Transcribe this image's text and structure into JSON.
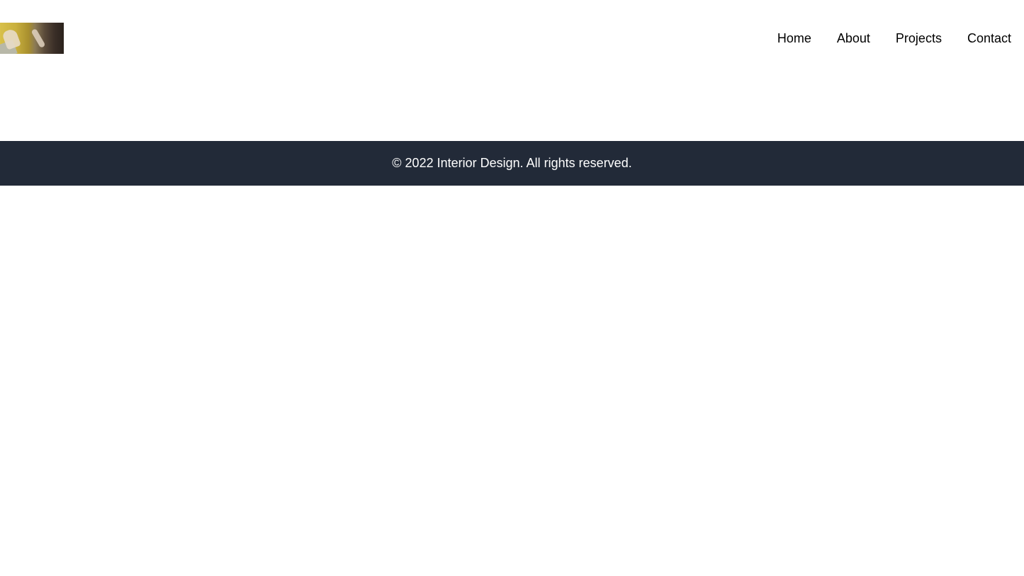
{
  "header": {
    "logo_alt": "Interior Design logo",
    "nav": [
      {
        "label": "Home"
      },
      {
        "label": "About"
      },
      {
        "label": "Projects"
      },
      {
        "label": "Contact"
      }
    ]
  },
  "footer": {
    "copyright": "© 2022 Interior Design. All rights reserved."
  },
  "colors": {
    "footer_bg": "#222a38",
    "footer_text": "#ffffff",
    "nav_text": "#000000"
  }
}
